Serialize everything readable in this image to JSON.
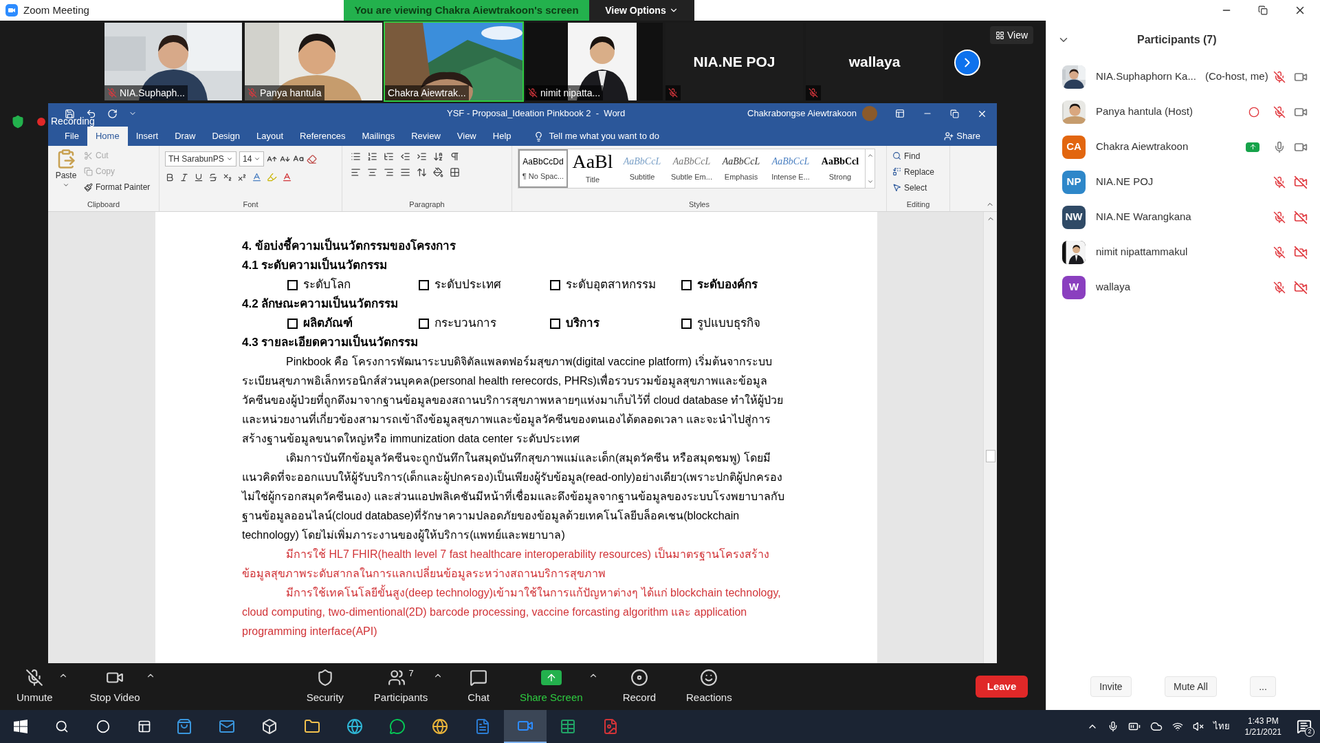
{
  "window": {
    "title": "Zoom Meeting"
  },
  "share_banner": {
    "text": "You are viewing Chakra Aiewtrakoon's screen",
    "view_options": "View Options"
  },
  "video_strip": {
    "tiles": [
      {
        "kind": "video",
        "name": "NIA.Suphaph...",
        "muted": true,
        "selected": false
      },
      {
        "kind": "video",
        "name": "Panya hantula",
        "muted": true,
        "selected": false
      },
      {
        "kind": "video",
        "name": "Chakra Aiewtrak...",
        "muted": false,
        "selected": true
      },
      {
        "kind": "video",
        "name": "nimit nipatta...",
        "muted": true,
        "selected": false
      },
      {
        "kind": "name",
        "name": "NIA.NE POJ",
        "muted": true,
        "selected": false
      },
      {
        "kind": "name",
        "name": "wallaya",
        "muted": true,
        "selected": false
      }
    ],
    "view_button": "View"
  },
  "recording": "Recording",
  "word": {
    "title": "YSF - Proposal_Ideation Pinkbook 2  -  Word",
    "user": "Chakrabongse Aiewtrakoon",
    "tabs": [
      {
        "label": "File",
        "selected": false
      },
      {
        "label": "Home",
        "selected": true
      },
      {
        "label": "Insert",
        "selected": false
      },
      {
        "label": "Draw",
        "selected": false
      },
      {
        "label": "Design",
        "selected": false
      },
      {
        "label": "Layout",
        "selected": false
      },
      {
        "label": "References",
        "selected": false
      },
      {
        "label": "Mailings",
        "selected": false
      },
      {
        "label": "Review",
        "selected": false
      },
      {
        "label": "View",
        "selected": false
      },
      {
        "label": "Help",
        "selected": false
      }
    ],
    "tell_me": "Tell me what you want to do",
    "share": "Share",
    "ribbon": {
      "clipboard": {
        "group": "Clipboard",
        "paste": "Paste",
        "items": [
          {
            "label": "Cut",
            "disabled": true
          },
          {
            "label": "Copy",
            "disabled": true
          },
          {
            "label": "Format Painter",
            "disabled": false
          }
        ]
      },
      "font": {
        "group": "Font",
        "name": "TH SarabunPS",
        "size": "14"
      },
      "paragraph": {
        "group": "Paragraph"
      },
      "styles": {
        "group": "Styles",
        "items": [
          {
            "kind": "normal",
            "sample": "AaBbCcDd",
            "label": "¶ No Spac...",
            "selected": true
          },
          {
            "kind": "title",
            "sample": "AaBl",
            "label": "Title",
            "selected": false
          },
          {
            "kind": "subtitle",
            "sample": "AaBbCcL",
            "label": "Subtitle",
            "selected": false
          },
          {
            "kind": "subtle",
            "sample": "AaBbCcL",
            "label": "Subtle Em...",
            "selected": false
          },
          {
            "kind": "emphasis",
            "sample": "AaBbCcL",
            "label": "Emphasis",
            "selected": false
          },
          {
            "kind": "intense",
            "sample": "AaBbCcL",
            "label": "Intense E...",
            "selected": false
          },
          {
            "kind": "strong",
            "sample": "AaBbCcl",
            "label": "Strong",
            "selected": false
          }
        ]
      },
      "editing": {
        "group": "Editing",
        "items": [
          "Find",
          "Replace",
          "Select"
        ]
      }
    },
    "document": {
      "blocks": [
        {
          "kind": "heading",
          "text": "4. ข้อบ่งชี้ความเป็นนวัตกรรมของโครงการ"
        },
        {
          "kind": "heading",
          "text": "4.1 ระดับความเป็นนวัตกรรม"
        },
        {
          "kind": "checkboxes",
          "items": [
            {
              "label": "ระดับโลก",
              "checked": false,
              "bold": false
            },
            {
              "label": "ระดับประเทศ",
              "checked": false,
              "bold": false
            },
            {
              "label": "ระดับอุตสาหกรรม",
              "checked": false,
              "bold": false
            },
            {
              "label": "ระดับองค์กร",
              "checked": false,
              "bold": true
            }
          ]
        },
        {
          "kind": "heading",
          "text": "4.2 ลักษณะความเป็นนวัตกรรม"
        },
        {
          "kind": "checkboxes",
          "items": [
            {
              "label": "ผลิตภัณฑ์",
              "checked": false,
              "bold": true
            },
            {
              "label": "กระบวนการ",
              "checked": false,
              "bold": false
            },
            {
              "label": "บริการ",
              "checked": false,
              "bold": true
            },
            {
              "label": "รูปแบบธุรกิจ",
              "checked": false,
              "bold": false
            }
          ]
        },
        {
          "kind": "heading",
          "text": "4.3 รายละเอียดความเป็นนวัตกรรม"
        },
        {
          "kind": "paragraph",
          "color": "#000000",
          "text": "Pinkbook คือ โครงการพัฒนาระบบดิจิตัลแพลตฟอร์มสุขภาพ(digital vaccine platform) เริ่มต้นจากระบบระเบียนสุขภาพอิเล็กทรอนิกส์ส่วนบุคคล(personal health rerecords, PHRs)เพื่อรวบรวมข้อมูลสุขภาพและข้อมูลวัคซีนของผู้ป่วยที่ถูกดึงมาจากฐานข้อมูลของสถานบริการสุขภาพหลายๆแห่งมาเก็บไว้ที่ cloud database ทำให้ผู้ป่วยและหน่วยงานที่เกี่ยวข้องสามารถเข้าถึงข้อมูลสุขภาพและข้อมูลวัคซีนของตนเองได้ตลอดเวลา และจะนำไปสู่การสร้างฐานข้อมูลขนาดใหญ่หรือ immunization data center ระดับประเทศ"
        },
        {
          "kind": "paragraph",
          "color": "#000000",
          "text": "เดิมการบันทึกข้อมูลวัคซีนจะถูกบันทึกในสมุดบันทึกสุขภาพแม่และเด็ก(สมุดวัคซีน หรือสมุดชมพู) โดยมีแนวคิดที่จะออกแบบให้ผู้รับบริการ(เด็กและผู้ปกครอง)เป็นเพียงผู้รับข้อมูล(read-only)อย่างเดียว(เพราะปกติผู้ปกครองไม่ใช่ผู้กรอกสมุดวัคซีนเอง) และส่วนแอปพลิเคชันมีหน้าที่เชื่อมและดึงข้อมูลจากฐานข้อมูลของระบบโรงพยาบาลกับฐานข้อมูลออนไลน์(cloud database)ที่รักษาความปลอดภัยของข้อมูลด้วยเทคโนโลยีบล็อคเชน(blockchain technology) โดยไม่เพิ่มภาระงานของผู้ให้บริการ(แพทย์และพยาบาล)"
        },
        {
          "kind": "paragraph",
          "color": "#d13438",
          "text": "มีการใช้ HL7 FHIR(health level 7 fast healthcare interoperability resources) เป็นมาตรฐานโครงสร้างข้อมูลสุขภาพระดับสากลในการแลกเปลี่ยนข้อมูลระหว่างสถานบริการสุขภาพ"
        },
        {
          "kind": "paragraph",
          "color": "#d13438",
          "text": "มีการใช้เทคโนโลยีขั้นสูง(deep technology)เข้ามาใช้ในการแก้ปัญหาต่างๆ ได้แก่ blockchain technology, cloud computing, two-dimentional(2D) barcode processing, vaccine forcasting algorithm และ application programming interface(API)"
        }
      ]
    }
  },
  "toolbar": {
    "items": [
      {
        "kind": "audio",
        "label": "Unmute",
        "caret": true
      },
      {
        "kind": "video",
        "label": "Stop Video",
        "caret": true
      },
      {
        "kind": "security",
        "label": "Security",
        "caret": false
      },
      {
        "kind": "participants",
        "label": "Participants",
        "count": "7",
        "caret": true
      },
      {
        "kind": "chat",
        "label": "Chat",
        "caret": false
      },
      {
        "kind": "share",
        "label": "Share Screen",
        "caret": true
      },
      {
        "kind": "record",
        "label": "Record",
        "caret": false
      },
      {
        "kind": "reactions",
        "label": "Reactions",
        "caret": false
      }
    ],
    "leave": "Leave"
  },
  "participants": {
    "title": "Participants (7)",
    "items": [
      {
        "name": "NIA.Suphaphorn Ka...",
        "role": "(Co-host, me)",
        "recording": false,
        "sharing": false,
        "mic_muted": true,
        "video_off": false
      },
      {
        "name": "Panya hantula (Host)",
        "recording": true,
        "sharing": false,
        "mic_muted": true,
        "video_off": false
      },
      {
        "name": "Chakra Aiewtrakoon",
        "avatar": {
          "kind": "initials",
          "text": "CA",
          "color": "#e2660f"
        },
        "recording": false,
        "sharing": true,
        "mic_muted": false,
        "video_off": false
      },
      {
        "name": "NIA.NE POJ",
        "avatar": {
          "kind": "initials",
          "text": "NP",
          "color": "#2e87c9"
        },
        "recording": false,
        "sharing": false,
        "mic_muted": true,
        "video_off": true
      },
      {
        "name": "NIA.NE Warangkana",
        "avatar": {
          "kind": "initials",
          "text": "NW",
          "color": "#2f4a66"
        },
        "recording": false,
        "sharing": false,
        "mic_muted": true,
        "video_off": true
      },
      {
        "name": "nimit nipattammakul",
        "recording": false,
        "sharing": false,
        "mic_muted": true,
        "video_off": true
      },
      {
        "name": "wallaya",
        "avatar": {
          "kind": "initials",
          "text": "W",
          "color": "#8a3fbf"
        },
        "recording": false,
        "sharing": false,
        "mic_muted": true,
        "video_off": true
      }
    ],
    "footer": [
      "Invite",
      "Mute All",
      "..."
    ]
  },
  "taskbar": {
    "apps": [
      {
        "kind": "store",
        "selected": false
      },
      {
        "kind": "mail",
        "selected": false
      },
      {
        "kind": "cube",
        "selected": false
      },
      {
        "kind": "folder",
        "selected": false
      },
      {
        "kind": "browser",
        "selected": false
      },
      {
        "kind": "chat",
        "selected": false
      },
      {
        "kind": "globe",
        "selected": false
      },
      {
        "kind": "document",
        "selected": false
      },
      {
        "kind": "camera",
        "selected": true
      },
      {
        "kind": "spreadsheet",
        "selected": false
      },
      {
        "kind": "pdf",
        "selected": false
      }
    ],
    "ime": "ไทย",
    "time": "1:43 PM",
    "date": "1/21/2021",
    "notifications": "2"
  }
}
